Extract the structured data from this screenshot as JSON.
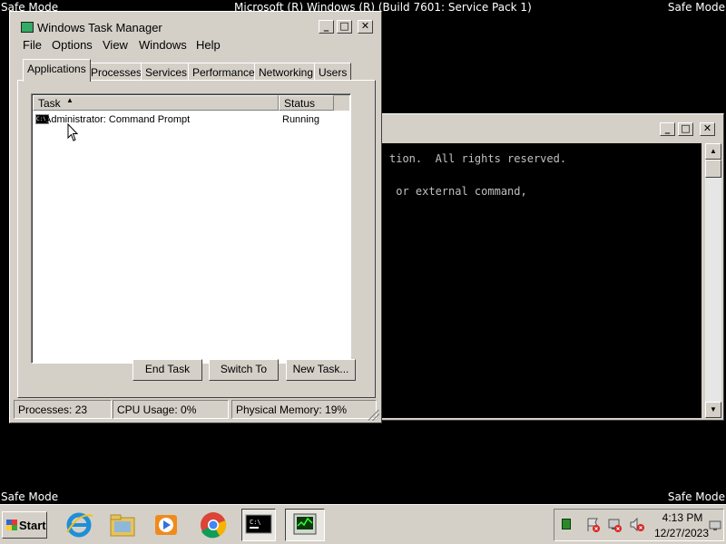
{
  "desktop": {
    "safe_mode_label": "Safe Mode",
    "os_title": "Microsoft (R) Windows (R) (Build 7601: Service Pack 1)"
  },
  "cmd_window": {
    "lines": [
      "tion.  All rights reserved.",
      " or external command,"
    ]
  },
  "task_manager": {
    "title": "Windows Task Manager",
    "menu": [
      "File",
      "Options",
      "View",
      "Windows",
      "Help"
    ],
    "tabs": [
      "Applications",
      "Processes",
      "Services",
      "Performance",
      "Networking",
      "Users"
    ],
    "active_tab": "Applications",
    "columns": {
      "task": "Task",
      "status": "Status"
    },
    "rows": [
      {
        "task": "Administrator:  Command Prompt",
        "status": "Running"
      }
    ],
    "buttons": {
      "end_task": "End Task",
      "switch_to": "Switch To",
      "new_task": "New Task..."
    },
    "status_bar": {
      "processes": "Processes: 23",
      "cpu": "CPU Usage: 0%",
      "memory": "Physical Memory: 19%"
    }
  },
  "taskbar": {
    "start_label": "Start",
    "pinned_icons": [
      "internet-explorer-icon",
      "windows-explorer-icon",
      "media-player-icon",
      "chrome-icon",
      "command-prompt-icon",
      "task-manager-icon"
    ],
    "tray_icons": [
      "task-manager-tray-icon",
      "action-center-icon",
      "network-icon",
      "volume-muted-icon"
    ],
    "clock": {
      "time": "4:13 PM",
      "date": "12/27/2023"
    }
  }
}
